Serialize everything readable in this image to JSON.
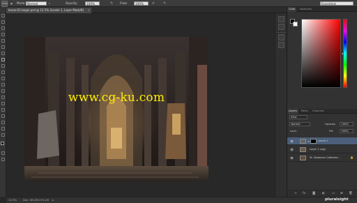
{
  "options_bar": {
    "size": "1900",
    "mode_label": "Mode:",
    "mode_value": "Normal",
    "opacity_label": "Opacity:",
    "opacity_value": "100%",
    "flow_label": "Flow:",
    "flow_value": "100%",
    "workspace": "Essentials"
  },
  "document": {
    "tab_title": "lesson21-begin.psd @ 12.5% (Levels 1, Layer Mask/8)",
    "zoom": "12.5%",
    "doc_info": "Doc: 98.2M/175.1M"
  },
  "watermark": "www.cg-ku.com",
  "panels": {
    "color_tabs": [
      "Color",
      "Swatches"
    ],
    "layers_tabs": [
      "Layers",
      "Paths",
      "Channels"
    ],
    "filter_kind": "Kind",
    "blend_mode": "Normal",
    "opacity_label": "Opacity:",
    "opacity_value": "100%",
    "lock_label": "Lock:",
    "fill_label": "Fill:",
    "fill_value": "100%",
    "layers": [
      {
        "name": "Levels 1",
        "selected": true
      },
      {
        "name": "Layer 1 copy",
        "selected": false
      },
      {
        "name": "St. Stephens Cathedra...",
        "selected": false
      }
    ]
  },
  "brand": "pluralsight",
  "colors": {
    "foreground": "#000000",
    "background": "#ffffff",
    "selection": "#4b5f7a",
    "watermark": "#ffee00"
  },
  "icons": {
    "eye": "eye-icon",
    "lock": "lock-icon",
    "link": "link-icon",
    "close": "close-icon"
  }
}
